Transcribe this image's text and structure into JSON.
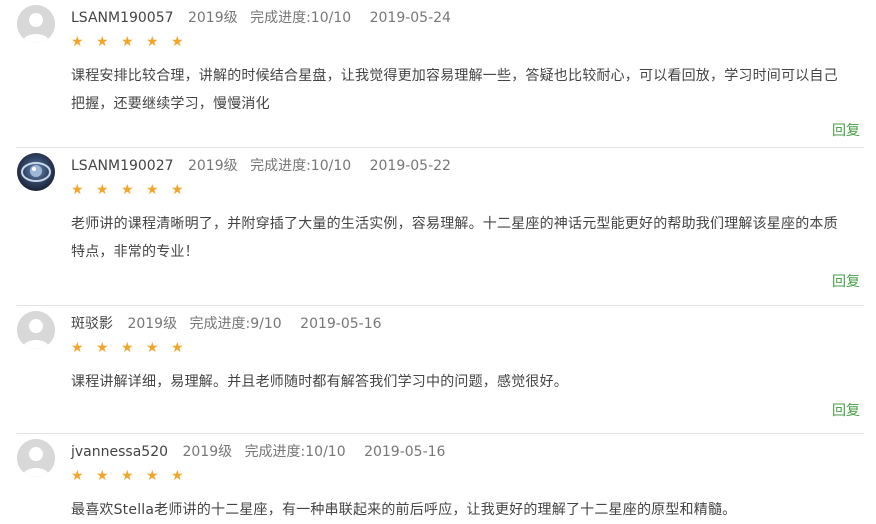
{
  "reviews": [
    {
      "username": "LSANM190057",
      "grade": "2019级",
      "progress": "完成进度:10/10",
      "date": "2019-05-24",
      "stars": "★ ★ ★ ★ ★",
      "rating": 5,
      "avatar": "default-avatar",
      "comment": "课程安排比较合理，讲解的时候结合星盘，让我觉得更加容易理解一些，答疑也比较耐心，可以看回放，学习时间可以自己把握，还要继续学习，慢慢消化",
      "reply_label": "回复"
    },
    {
      "username": "LSANM190027",
      "grade": "2019级",
      "progress": "完成进度:10/10",
      "date": "2019-05-22",
      "stars": "★ ★ ★ ★ ★",
      "rating": 5,
      "avatar": "photo-avatar",
      "comment": "老师讲的课程清晰明了，并附穿插了大量的生活实例，容易理解。十二星座的神话元型能更好的帮助我们理解该星座的本质特点，非常的专业！",
      "reply_label": "回复"
    },
    {
      "username": "斑驳影",
      "grade": "2019级",
      "progress": "完成进度:9/10",
      "date": "2019-05-16",
      "stars": "★ ★ ★ ★ ★",
      "rating": 5,
      "avatar": "default-avatar",
      "comment": "课程讲解详细，易理解。并且老师随时都有解答我们学习中的问题，感觉很好。",
      "reply_label": "回复"
    },
    {
      "username": "jvannessa520",
      "grade": "2019级",
      "progress": "完成进度:10/10",
      "date": "2019-05-16",
      "stars": "★ ★ ★ ★ ★",
      "rating": 5,
      "avatar": "default-avatar",
      "comment": "最喜欢Stella老师讲的十二星座，有一种串联起来的前后呼应，让我更好的理解了十二星座的原型和精髓。"
    }
  ],
  "colors": {
    "star": "#f0a52b",
    "reply": "#46a047",
    "divider": "#e4e4e4"
  }
}
